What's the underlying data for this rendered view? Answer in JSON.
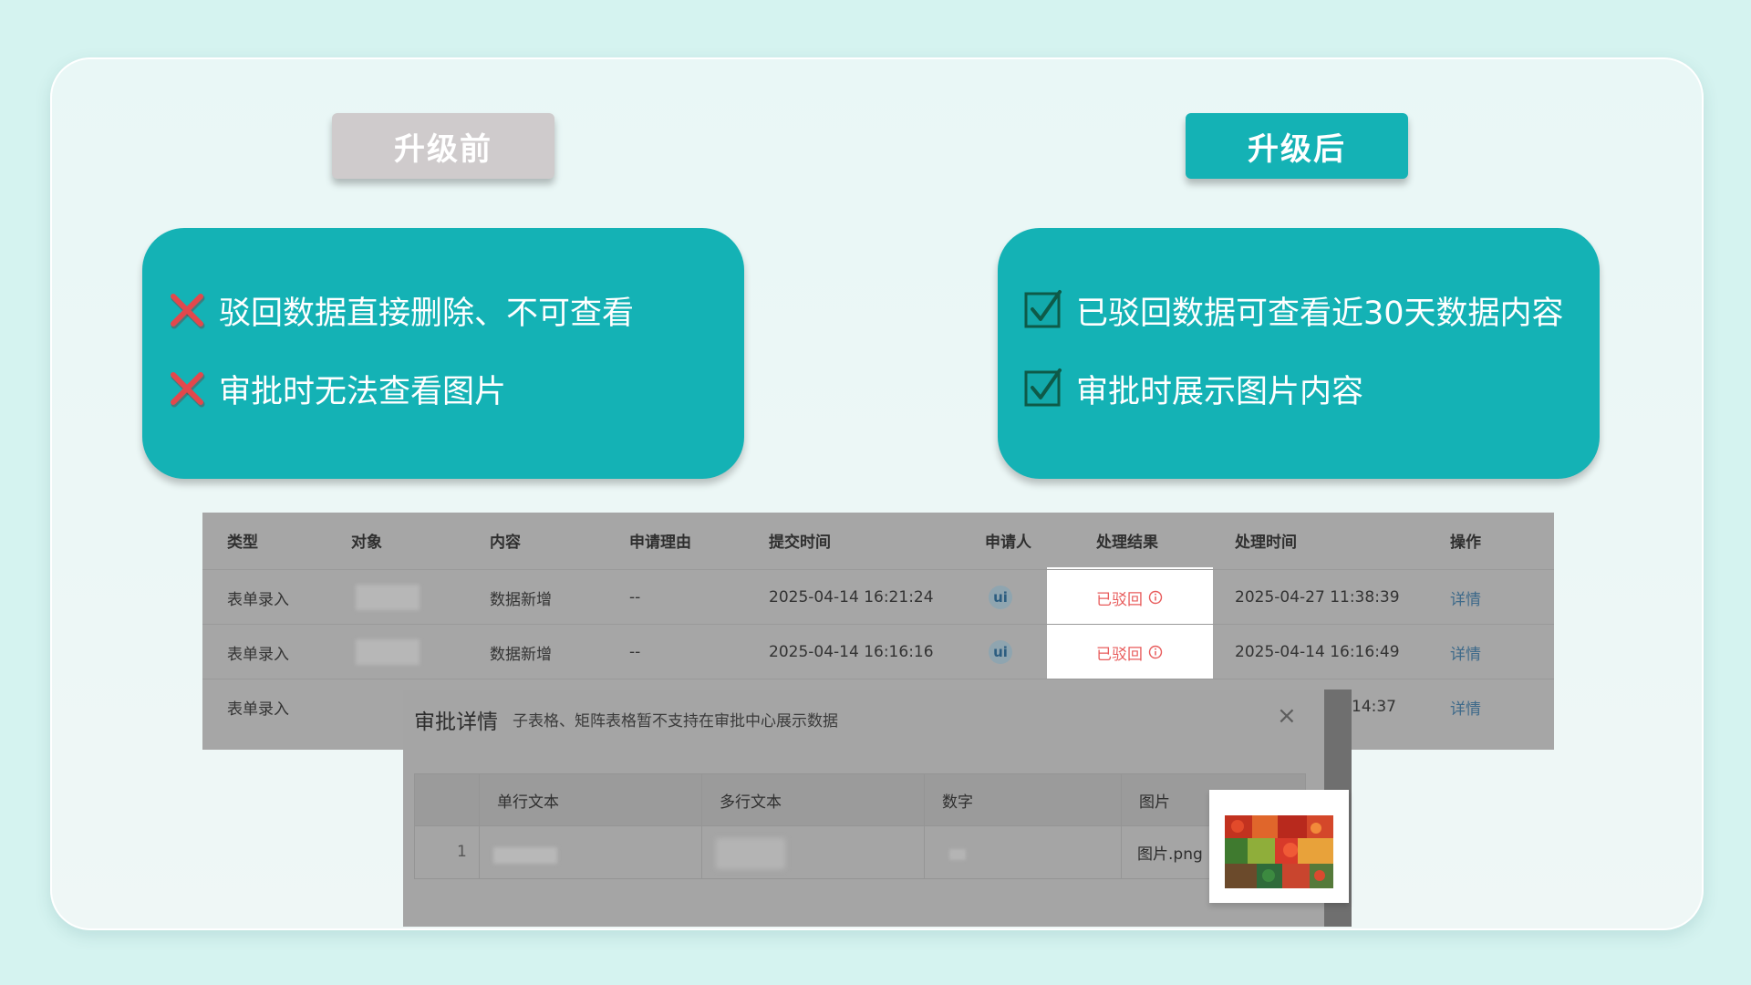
{
  "labels": {
    "before": "升级前",
    "after": "升级后"
  },
  "before_points": [
    "驳回数据直接删除、不可查看",
    "审批时无法查看图片"
  ],
  "after_points": [
    "已驳回数据可查看近30天数据内容",
    "审批时展示图片内容"
  ],
  "colors": {
    "teal": "#14b2b5",
    "gray_pill": "#cfcbcc",
    "reject_red": "#e85c5c"
  },
  "table": {
    "headers": [
      "类型",
      "对象",
      "内容",
      "申请理由",
      "提交时间",
      "申请人",
      "处理结果",
      "处理时间",
      "操作"
    ],
    "rows": [
      {
        "type": "表单录入",
        "content": "数据新增",
        "reason": "--",
        "submit_time": "2025-04-14 16:21:24",
        "result": "已驳回",
        "process_time": "2025-04-27 11:38:39",
        "action": "详情"
      },
      {
        "type": "表单录入",
        "content": "数据新增",
        "reason": "--",
        "submit_time": "2025-04-14 16:16:16",
        "result": "已驳回",
        "process_time": "2025-04-14 16:16:49",
        "action": "详情"
      },
      {
        "type": "表单录入",
        "process_time_partial": "14:37",
        "action": "详情"
      }
    ]
  },
  "dialog": {
    "title": "审批详情",
    "note": "子表格、矩阵表格暂不支持在审批中心展示数据",
    "close": "×",
    "columns": [
      "单行文本",
      "多行文本",
      "数字",
      "图片"
    ],
    "row_index": "1",
    "image_file": "图片.png"
  },
  "icons": {
    "cross": "cross-mark-icon",
    "check": "checkbox-check-icon",
    "info": "info-circle-icon",
    "close": "close-icon"
  }
}
